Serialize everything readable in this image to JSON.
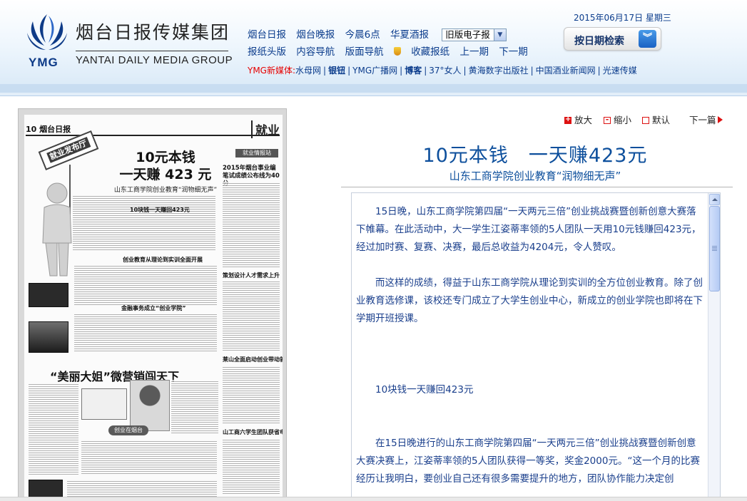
{
  "header": {
    "logo_text_cn": "烟台日报传媒集团",
    "logo_text_en": "YANTAI DAILY MEDIA GROUP",
    "logo_abbr": "YMG",
    "nav_row1": [
      {
        "label": "烟台日报"
      },
      {
        "label": "烟台晚报"
      },
      {
        "label": "今晨6点"
      },
      {
        "label": "华夏酒报"
      }
    ],
    "edition_select": {
      "selected": "旧版电子报"
    },
    "nav_row2": [
      {
        "label": "报纸头版"
      },
      {
        "label": "内容导航"
      },
      {
        "label": "版面导航"
      },
      {
        "label": "收藏报纸"
      },
      {
        "label": "上一期"
      },
      {
        "label": "下一期"
      }
    ],
    "media_prefix": "YMG新媒体:",
    "media_links": [
      {
        "label": "水母网",
        "bold": false
      },
      {
        "label": "银钮",
        "bold": true
      },
      {
        "label": "YMG广播网",
        "bold": false
      },
      {
        "label": "博客",
        "bold": true
      },
      {
        "label": "37°女人",
        "bold": false
      },
      {
        "label": "黄海数字出版社",
        "bold": false
      },
      {
        "label": "中国酒业新闻网",
        "bold": false
      },
      {
        "label": "光速传媒",
        "bold": false
      }
    ],
    "date": "2015年06月17日 星期三",
    "date_search_label": "按日期检索",
    "colors": {
      "nav_link": "#0b3c8c",
      "media_prefix": "#e60000",
      "title_blue": "#0d4f9c"
    }
  },
  "newspaper": {
    "page_no": "10",
    "masthead": "烟台日报",
    "section": "就业",
    "sign_tag": "就业发布厅",
    "headline_line1": "10元本钱",
    "headline_line2": "一天赚 423 元",
    "subheadline": "山东工商学院创业教育“润物细无声”",
    "side_column_head": "就业情报站",
    "side_title_1": "2015年烟台事业编笔试成绩公布线为40分",
    "side_title_2": "策划设计人才需求上升",
    "side_title_3": "莱山全面启动创业带动就业实施工程",
    "side_title_4": "山工商六学生团队获省电子商务专业竞赛奖",
    "headline2": "“美丽大姐”微营销闯天下",
    "pill_label": "创业在烟台",
    "small_titles": [
      "10块钱一天赚回423元",
      "创业教育从理论到实训全面开展",
      "金融事务成立“创业学院”"
    ]
  },
  "tools": {
    "zoom_in": "放大",
    "zoom_out": "缩小",
    "default": "默认",
    "next_article": "下一篇"
  },
  "article": {
    "title": "10元本钱　一天赚423元",
    "subtitle": "山东工商学院创业教育“润物细无声”",
    "paragraphs": [
      "15日晚，山东工商学院第四届“一天两元三倍”创业挑战赛暨创新创意大赛落下帷幕。在此活动中，大一学生江姿蒂率领的5人团队一天用10元钱赚回423元，经过加时赛、复赛、决赛，最后总收益为4204元，令人赞叹。",
      "而这样的成绩，得益于山东工商学院从理论到实训的全方位创业教育。除了创业教育选修课，该校还专门成立了大学生创业中心，新成立的创业学院也即将在下学期开班授课。",
      "10块钱一天赚回423元",
      "在15日晚进行的山东工商学院第四届“一天两元三倍”创业挑战赛暨创新创意大赛决赛上，江姿蒂率领的5人团队获得一等奖，奖金2000元。“这一个月的比赛经历让我明白，要创业自己还有很多需要提升的地方，团队协作能力决定创"
    ]
  }
}
